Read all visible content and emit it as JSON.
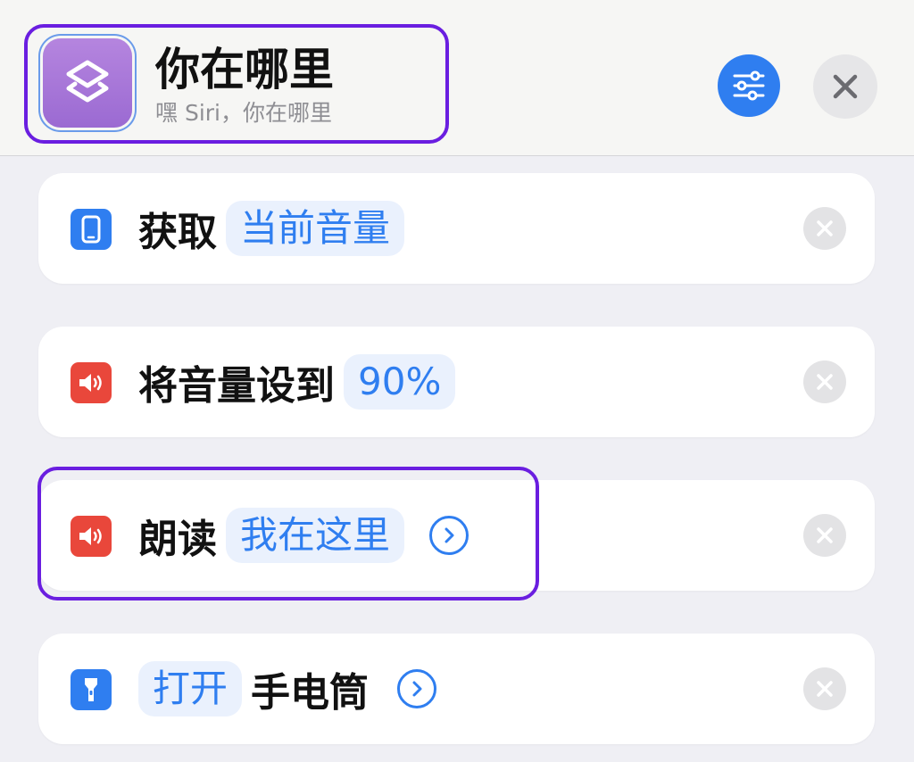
{
  "header": {
    "title": "你在哪里",
    "subtitle": "嘿 Siri，你在哪里",
    "app_icon": "shortcuts-layers-icon",
    "settings_icon": "sliders-icon",
    "close_icon": "close-icon"
  },
  "actions": [
    {
      "icon": "phone-icon",
      "icon_color": "#2f7ef0",
      "text_before": "获取",
      "token": "当前音量",
      "text_after": "",
      "has_chevron": false
    },
    {
      "icon": "speaker-icon",
      "icon_color": "#e9473b",
      "text_before": "将音量设到",
      "token": "90%",
      "text_after": "",
      "has_chevron": false
    },
    {
      "icon": "speaker-icon",
      "icon_color": "#e9473b",
      "text_before": "朗读",
      "token": "我在这里",
      "text_after": "",
      "has_chevron": true
    },
    {
      "icon": "flashlight-icon",
      "icon_color": "#2f7ef0",
      "text_before": "",
      "token": "打开",
      "text_after": "手电筒",
      "has_chevron": true
    }
  ],
  "colors": {
    "accent": "#2f7ef0",
    "highlight": "#6a1ee0",
    "speaker_red": "#e9473b",
    "app_purple": "#a674db"
  }
}
